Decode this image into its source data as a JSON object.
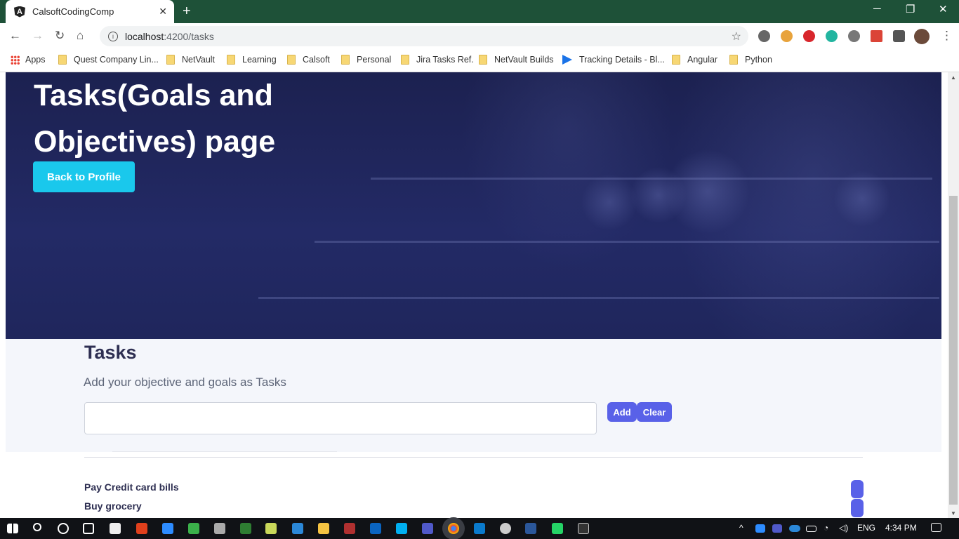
{
  "browser": {
    "tab_title": "CalsoftCodingComp",
    "tab_favicon": "angular-icon",
    "url_host": "localhost",
    "url_path": ":4200/tasks",
    "new_tab_label": "+",
    "bookmarks": [
      {
        "label": "Apps",
        "icon": "apps-grid-icon"
      },
      {
        "label": "Quest Company Lin...",
        "icon": "folder-icon"
      },
      {
        "label": "NetVault",
        "icon": "folder-icon"
      },
      {
        "label": "Learning",
        "icon": "folder-icon"
      },
      {
        "label": "Calsoft",
        "icon": "folder-icon"
      },
      {
        "label": "Personal",
        "icon": "folder-icon"
      },
      {
        "label": "Jira Tasks Ref.",
        "icon": "folder-icon"
      },
      {
        "label": "NetVault Builds",
        "icon": "folder-icon"
      },
      {
        "label": "Tracking Details - Bl...",
        "icon": "tracking-icon"
      },
      {
        "label": "Angular",
        "icon": "folder-icon"
      },
      {
        "label": "Python",
        "icon": "folder-icon"
      }
    ]
  },
  "hero": {
    "title": "Tasks(Goals and Objectives) page",
    "back_button_label": "Back to Profile"
  },
  "tasks": {
    "heading": "Tasks",
    "subtitle": "Add your objective and goals as Tasks",
    "input_value": "",
    "add_label": "Add",
    "clear_label": "Clear",
    "items": [
      "Pay Credit card bills",
      "Buy grocery"
    ]
  },
  "taskbar": {
    "language": "ENG",
    "time": "4:34 PM"
  },
  "colors": {
    "titlebar": "#1e5138",
    "hero_bg": "#1f265c",
    "accent_cyan": "#1ac8ec",
    "accent_indigo": "#5961e8"
  }
}
